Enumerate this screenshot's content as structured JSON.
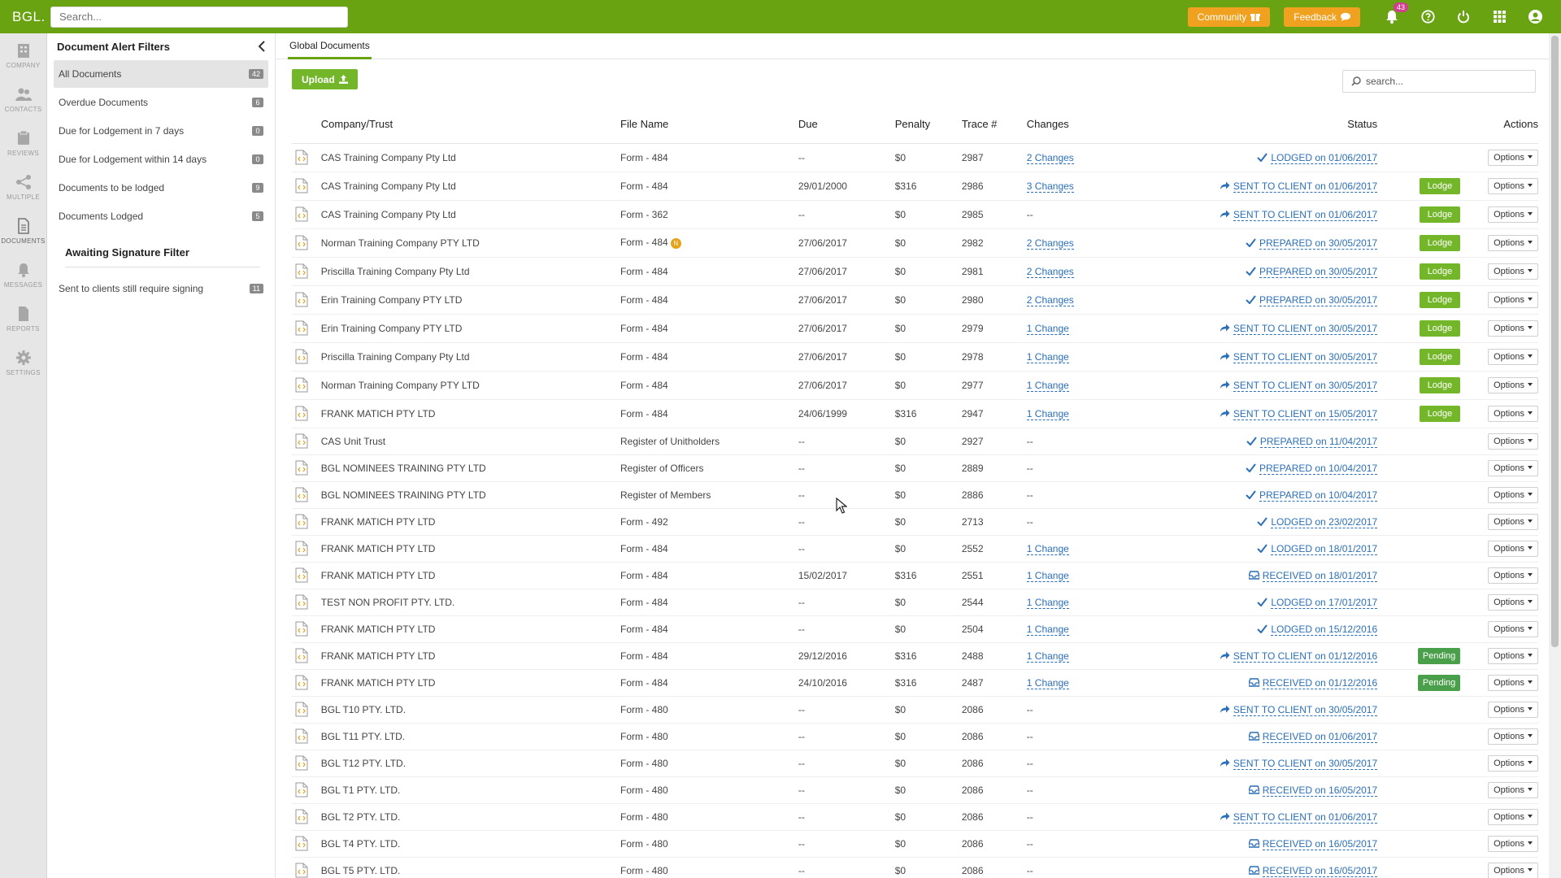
{
  "header": {
    "logo": "BGL.",
    "search_placeholder": "Search...",
    "community_label": "Community",
    "feedback_label": "Feedback",
    "notification_count": "43"
  },
  "rail": [
    {
      "label": "COMPANY",
      "icon": "company-icon"
    },
    {
      "label": "CONTACTS",
      "icon": "contacts-icon"
    },
    {
      "label": "REVIEWS",
      "icon": "reviews-icon"
    },
    {
      "label": "MULTIPLE",
      "icon": "share-icon"
    },
    {
      "label": "DOCUMENTS",
      "icon": "documents-icon"
    },
    {
      "label": "MESSAGES",
      "icon": "bell-icon"
    },
    {
      "label": "REPORTS",
      "icon": "reports-icon"
    },
    {
      "label": "SETTINGS",
      "icon": "gear-icon"
    }
  ],
  "filters": {
    "title": "Document Alert Filters",
    "items": [
      {
        "label": "All Documents",
        "count": "42"
      },
      {
        "label": "Overdue Documents",
        "count": "6"
      },
      {
        "label": "Due for Lodgement in 7 days",
        "count": "0"
      },
      {
        "label": "Due for Lodgement within 14 days",
        "count": "0"
      },
      {
        "label": "Documents to be lodged",
        "count": "9"
      },
      {
        "label": "Documents Lodged",
        "count": "5"
      }
    ],
    "signature_title": "Awaiting Signature Filter",
    "signature_item": {
      "label": "Sent to clients still require signing",
      "count": "11"
    }
  },
  "main": {
    "tab": "Global Documents",
    "upload_label": "Upload",
    "search_placeholder": "search...",
    "columns": [
      "Company/Trust",
      "File Name",
      "Due",
      "Penalty",
      "Trace #",
      "Changes",
      "Status",
      "Actions"
    ],
    "options_label": "Options",
    "rows": [
      {
        "company": "CAS Training Company Pty Ltd",
        "file": "Form - 484",
        "due": "--",
        "penalty": "$0",
        "trace": "2987",
        "changes": "2 Changes",
        "status": "LODGED on 01/06/2017",
        "status_type": "lodged",
        "button": ""
      },
      {
        "company": "CAS Training Company Pty Ltd",
        "file": "Form - 484",
        "due": "29/01/2000",
        "penalty": "$316",
        "trace": "2986",
        "changes": "3 Changes",
        "status": "SENT TO CLIENT on 01/06/2017",
        "status_type": "sent",
        "button": "Lodge"
      },
      {
        "company": "CAS Training Company Pty Ltd",
        "file": "Form - 362",
        "due": "--",
        "penalty": "$0",
        "trace": "2985",
        "changes": "--",
        "status": "SENT TO CLIENT on 01/06/2017",
        "status_type": "sent",
        "button": "Lodge"
      },
      {
        "company": "Norman Training Company PTY LTD",
        "file": "Form - 484",
        "badge": "N",
        "due": "27/06/2017",
        "penalty": "$0",
        "trace": "2982",
        "changes": "2 Changes",
        "status": "PREPARED on 30/05/2017",
        "status_type": "prepared",
        "button": "Lodge"
      },
      {
        "company": "Priscilla Training Company Pty Ltd",
        "file": "Form - 484",
        "due": "27/06/2017",
        "penalty": "$0",
        "trace": "2981",
        "changes": "2 Changes",
        "status": "PREPARED on 30/05/2017",
        "status_type": "prepared",
        "button": "Lodge"
      },
      {
        "company": "Erin Training Company PTY LTD",
        "file": "Form - 484",
        "due": "27/06/2017",
        "penalty": "$0",
        "trace": "2980",
        "changes": "2 Changes",
        "status": "PREPARED on 30/05/2017",
        "status_type": "prepared",
        "button": "Lodge"
      },
      {
        "company": "Erin Training Company PTY LTD",
        "file": "Form - 484",
        "due": "27/06/2017",
        "penalty": "$0",
        "trace": "2979",
        "changes": "1 Change",
        "status": "SENT TO CLIENT on 30/05/2017",
        "status_type": "sent",
        "button": "Lodge"
      },
      {
        "company": "Priscilla Training Company Pty Ltd",
        "file": "Form - 484",
        "due": "27/06/2017",
        "penalty": "$0",
        "trace": "2978",
        "changes": "1 Change",
        "status": "SENT TO CLIENT on 30/05/2017",
        "status_type": "sent",
        "button": "Lodge"
      },
      {
        "company": "Norman Training Company PTY LTD",
        "file": "Form - 484",
        "due": "27/06/2017",
        "penalty": "$0",
        "trace": "2977",
        "changes": "1 Change",
        "status": "SENT TO CLIENT on 30/05/2017",
        "status_type": "sent",
        "button": "Lodge"
      },
      {
        "company": "FRANK MATICH PTY LTD",
        "file": "Form - 484",
        "due": "24/06/1999",
        "penalty": "$316",
        "trace": "2947",
        "changes": "1 Change",
        "status": "SENT TO CLIENT on 15/05/2017",
        "status_type": "sent",
        "button": "Lodge"
      },
      {
        "company": "CAS Unit Trust",
        "file": "Register of Unitholders",
        "due": "--",
        "penalty": "$0",
        "trace": "2927",
        "changes": "--",
        "status": "PREPARED on 11/04/2017",
        "status_type": "prepared",
        "button": ""
      },
      {
        "company": "BGL NOMINEES TRAINING PTY LTD",
        "file": "Register of Officers",
        "due": "--",
        "penalty": "$0",
        "trace": "2889",
        "changes": "--",
        "status": "PREPARED on 10/04/2017",
        "status_type": "prepared",
        "button": ""
      },
      {
        "company": "BGL NOMINEES TRAINING PTY LTD",
        "file": "Register of Members",
        "due": "--",
        "penalty": "$0",
        "trace": "2886",
        "changes": "--",
        "status": "PREPARED on 10/04/2017",
        "status_type": "prepared",
        "button": ""
      },
      {
        "company": "FRANK MATICH PTY LTD",
        "file": "Form - 492",
        "due": "--",
        "penalty": "$0",
        "trace": "2713",
        "changes": "--",
        "status": "LODGED on 23/02/2017",
        "status_type": "lodged",
        "button": ""
      },
      {
        "company": "FRANK MATICH PTY LTD",
        "file": "Form - 484",
        "due": "--",
        "penalty": "$0",
        "trace": "2552",
        "changes": "1 Change",
        "status": "LODGED on 18/01/2017",
        "status_type": "lodged",
        "button": ""
      },
      {
        "company": "FRANK MATICH PTY LTD",
        "file": "Form - 484",
        "due": "15/02/2017",
        "penalty": "$316",
        "trace": "2551",
        "changes": "1 Change",
        "status": "RECEIVED on 18/01/2017",
        "status_type": "received",
        "button": ""
      },
      {
        "company": "TEST NON PROFIT PTY. LTD.",
        "file": "Form - 484",
        "due": "--",
        "penalty": "$0",
        "trace": "2544",
        "changes": "1 Change",
        "status": "LODGED on 17/01/2017",
        "status_type": "lodged",
        "button": ""
      },
      {
        "company": "FRANK MATICH PTY LTD",
        "file": "Form - 484",
        "due": "--",
        "penalty": "$0",
        "trace": "2504",
        "changes": "1 Change",
        "status": "LODGED on 15/12/2016",
        "status_type": "lodged",
        "button": ""
      },
      {
        "company": "FRANK MATICH PTY LTD",
        "file": "Form - 484",
        "due": "29/12/2016",
        "penalty": "$316",
        "trace": "2488",
        "changes": "1 Change",
        "status": "SENT TO CLIENT on 01/12/2016",
        "status_type": "sent",
        "button": "Pending"
      },
      {
        "company": "FRANK MATICH PTY LTD",
        "file": "Form - 484",
        "due": "24/10/2016",
        "penalty": "$316",
        "trace": "2487",
        "changes": "1 Change",
        "status": "RECEIVED on 01/12/2016",
        "status_type": "received",
        "button": "Pending"
      },
      {
        "company": "BGL T10 PTY. LTD.",
        "file": "Form - 480",
        "due": "--",
        "penalty": "$0",
        "trace": "2086",
        "changes": "--",
        "status": "SENT TO CLIENT on 30/05/2017",
        "status_type": "sent",
        "button": ""
      },
      {
        "company": "BGL T11 PTY. LTD.",
        "file": "Form - 480",
        "due": "--",
        "penalty": "$0",
        "trace": "2086",
        "changes": "--",
        "status": "RECEIVED on 01/06/2017",
        "status_type": "received",
        "button": ""
      },
      {
        "company": "BGL T12 PTY. LTD.",
        "file": "Form - 480",
        "due": "--",
        "penalty": "$0",
        "trace": "2086",
        "changes": "--",
        "status": "SENT TO CLIENT on 30/05/2017",
        "status_type": "sent",
        "button": ""
      },
      {
        "company": "BGL T1 PTY. LTD.",
        "file": "Form - 480",
        "due": "--",
        "penalty": "$0",
        "trace": "2086",
        "changes": "--",
        "status": "RECEIVED on 16/05/2017",
        "status_type": "received",
        "button": ""
      },
      {
        "company": "BGL T2 PTY. LTD.",
        "file": "Form - 480",
        "due": "--",
        "penalty": "$0",
        "trace": "2086",
        "changes": "--",
        "status": "SENT TO CLIENT on 01/06/2017",
        "status_type": "sent",
        "button": ""
      },
      {
        "company": "BGL T4 PTY. LTD.",
        "file": "Form - 480",
        "due": "--",
        "penalty": "$0",
        "trace": "2086",
        "changes": "--",
        "status": "RECEIVED on 16/05/2017",
        "status_type": "received",
        "button": ""
      },
      {
        "company": "BGL T5 PTY. LTD.",
        "file": "Form - 480",
        "due": "--",
        "penalty": "$0",
        "trace": "2086",
        "changes": "--",
        "status": "RECEIVED on 16/05/2017",
        "status_type": "received",
        "button": ""
      }
    ]
  },
  "colors": {
    "brand_green": "#6aa312",
    "accent_orange": "#f0a11f",
    "link_blue": "#2b6fb8",
    "button_green": "#74b62a"
  }
}
